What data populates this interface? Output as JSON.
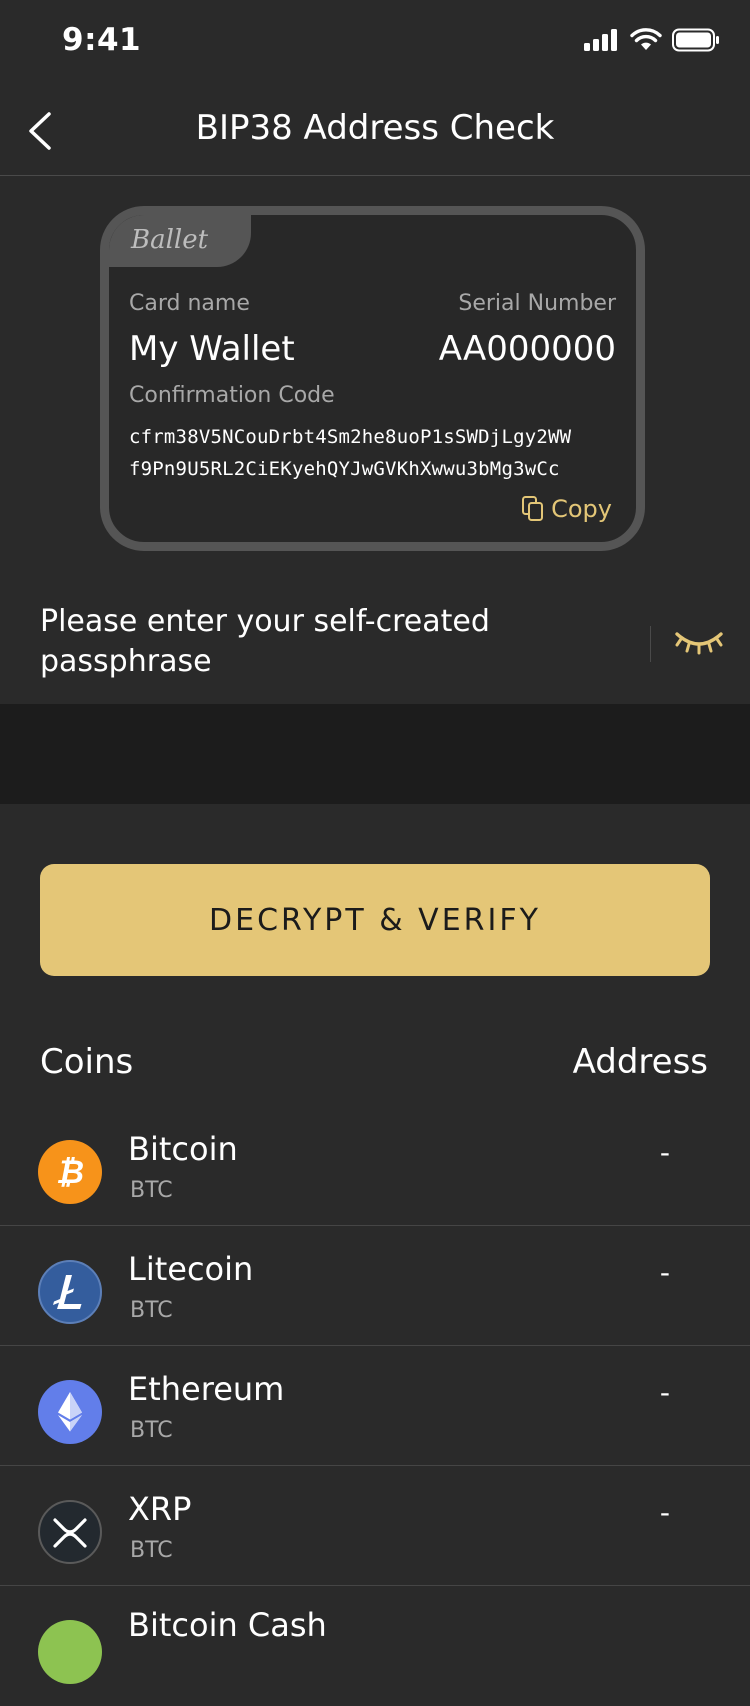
{
  "status_bar": {
    "time": "9:41"
  },
  "nav": {
    "title": "BIP38 Address Check"
  },
  "card": {
    "brand": "Ballet",
    "card_name_label": "Card name",
    "card_name_value": "My Wallet",
    "serial_label": "Serial Number",
    "serial_value": "AA000000",
    "confirmation_label": "Confirmation Code",
    "confirmation_line1": "cfrm38V5NCouDrbt4Sm2he8uoP1sSWDjLgy2WW",
    "confirmation_line2": "f9Pn9U5RL2CiEKyehQYJwGVKhXwwu3bMg3wCc",
    "copy_label": "Copy"
  },
  "passphrase": {
    "placeholder": "Please enter your self-created passphrase",
    "value": ""
  },
  "decrypt_button": {
    "label": "DECRYPT & VERIFY"
  },
  "table": {
    "coins_header": "Coins",
    "address_header": "Address",
    "rows": [
      {
        "name": "Bitcoin",
        "symbol": "BTC",
        "address": "-",
        "icon": "bitcoin-icon",
        "color": "#f7931a"
      },
      {
        "name": "Litecoin",
        "symbol": "BTC",
        "address": "-",
        "icon": "litecoin-icon",
        "color": "#345d9d"
      },
      {
        "name": "Ethereum",
        "symbol": "BTC",
        "address": "-",
        "icon": "ethereum-icon",
        "color": "#627eea"
      },
      {
        "name": "XRP",
        "symbol": "BTC",
        "address": "-",
        "icon": "xrp-icon",
        "color": "#23292f"
      },
      {
        "name": "Bitcoin Cash",
        "symbol": "",
        "address": "",
        "icon": "bitcoin-cash-icon",
        "color": "#8dc351"
      }
    ]
  },
  "colors": {
    "background": "#2a2a2a",
    "accent": "#e4c677",
    "band": "#1c1c1c"
  }
}
